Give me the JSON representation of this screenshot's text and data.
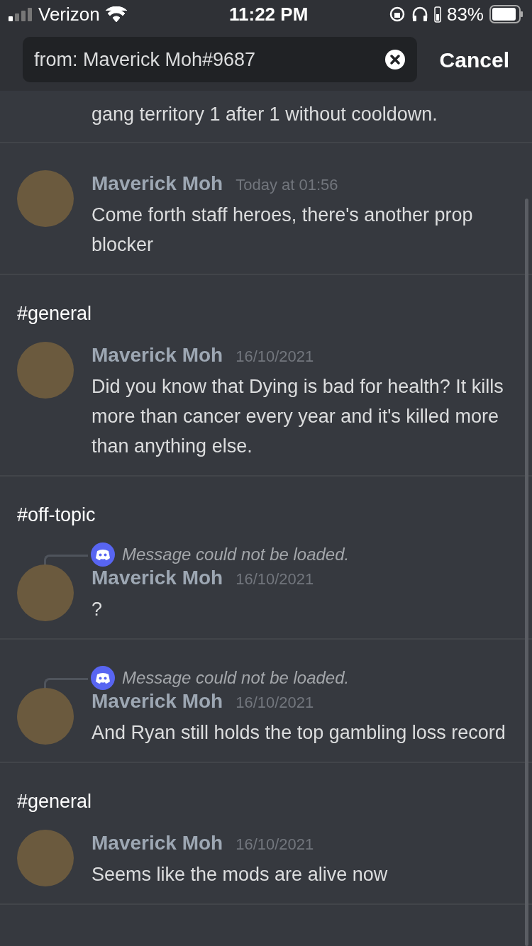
{
  "status_bar": {
    "carrier": "Verizon",
    "time": "11:22 PM",
    "battery": "83%"
  },
  "search": {
    "value": "from: Maverick Moh#9687",
    "cancel": "Cancel"
  },
  "messages": [
    {
      "kind": "partial",
      "text": "gang territory 1 after 1 without cooldown."
    },
    {
      "kind": "message",
      "author": "Maverick Moh",
      "time": "Today at 01:56",
      "text": "Come forth staff heroes, there's another prop blocker"
    },
    {
      "kind": "message",
      "channel": "#general",
      "author": "Maverick Moh",
      "time": "16/10/2021",
      "text": "Did you know that Dying is bad for health? It kills more than cancer every year and it's killed more than anything else."
    },
    {
      "kind": "message",
      "channel": "#off-topic",
      "reply": "Message could not be loaded.",
      "author": "Maverick Moh",
      "time": "16/10/2021",
      "text": "?"
    },
    {
      "kind": "message",
      "reply": "Message could not be loaded.",
      "author": "Maverick Moh",
      "time": "16/10/2021",
      "text": "And Ryan still holds the top gambling loss record"
    },
    {
      "kind": "message",
      "channel": "#general",
      "author": "Maverick Moh",
      "time": "16/10/2021",
      "text": "Seems like the mods are alive now"
    }
  ]
}
